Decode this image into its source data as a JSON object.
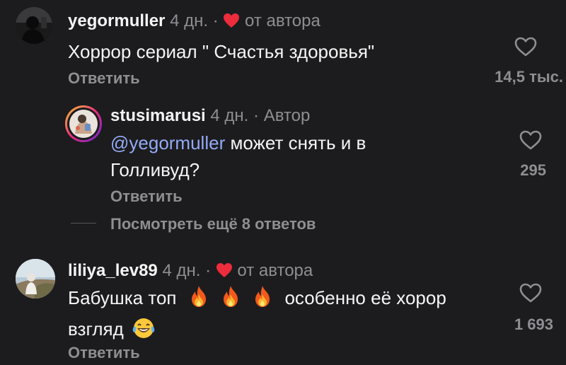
{
  "comments": [
    {
      "username": "yegormuller",
      "age": "4 дн.",
      "separator": "·",
      "liked_by_author": "от автора",
      "text": "Хоррор сериал \" Счастья здоровья\"",
      "reply_label": "Ответить",
      "like_count": "14,5 тыс.",
      "avatar": "dark-silhouette-avatar"
    },
    {
      "username": "stusimarusi",
      "age": "4 дн.",
      "separator": "·",
      "author_tag": "Автор",
      "mention": "@yegormuller",
      "text_line1": "может снять и в",
      "text_line2": "Голливуд?",
      "reply_label": "Ответить",
      "like_count": "295",
      "avatar": "story-ring-avatar"
    },
    {
      "username": "liliya_lev89",
      "age": "4 дн.",
      "separator": "·",
      "liked_by_author": "от автора",
      "text_before": "Бабушка топ",
      "text_after": "особенно её хорор",
      "text_line2": "взгляд",
      "reply_label": "Ответить",
      "like_count": "1 693",
      "avatar": "outdoor-photo-avatar"
    }
  ],
  "view_more_replies": "Посмотреть ещё 8 ответов",
  "icons": {
    "like": "heart-outline-icon",
    "author_like": "red-heart-icon",
    "fire": "fire-emoji",
    "laugh": "tears-of-joy-emoji"
  },
  "colors": {
    "background": "#1c1c1e",
    "primary_text": "#f5f5f5",
    "secondary_text": "#8e8e93",
    "mention": "#93a9f5",
    "author_heart": "#ed2c3c"
  }
}
